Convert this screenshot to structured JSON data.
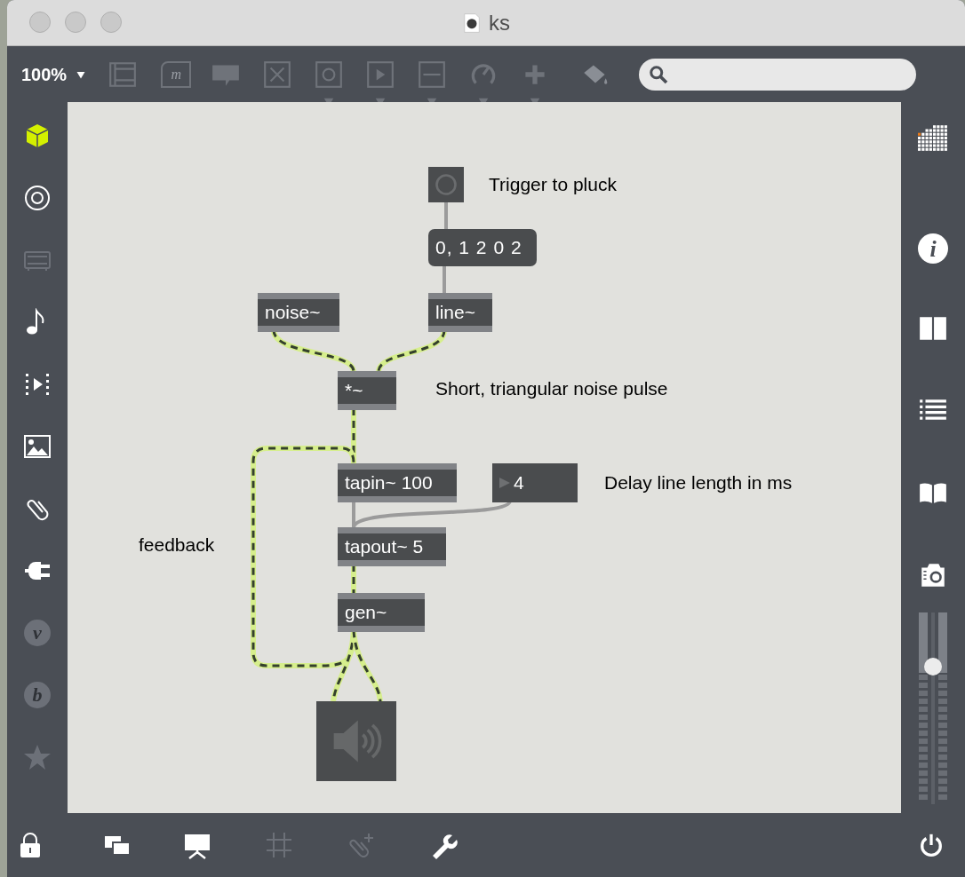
{
  "window": {
    "title": "ks"
  },
  "toolbar": {
    "zoom": "100%",
    "tools": [
      {
        "kind": "list-box",
        "menu": false
      },
      {
        "kind": "message",
        "glyph": "m",
        "menu": false
      },
      {
        "kind": "comment",
        "menu": false
      },
      {
        "kind": "toggle",
        "menu": false
      },
      {
        "kind": "button",
        "menu": true
      },
      {
        "kind": "playbar",
        "menu": true
      },
      {
        "kind": "slider",
        "menu": true
      },
      {
        "kind": "dial",
        "menu": true
      },
      {
        "kind": "plus",
        "menu": true
      },
      {
        "kind": "paint",
        "menu": false
      }
    ]
  },
  "left_sidebar": {
    "items": [
      {
        "kind": "cube",
        "disabled": false
      },
      {
        "kind": "target",
        "disabled": false
      },
      {
        "kind": "tablet",
        "disabled": true
      },
      {
        "kind": "note",
        "disabled": false
      },
      {
        "kind": "video",
        "disabled": false
      },
      {
        "kind": "image",
        "disabled": false
      },
      {
        "kind": "clip",
        "disabled": false
      },
      {
        "kind": "plug",
        "disabled": false
      },
      {
        "kind": "letter",
        "glyph": "v",
        "disabled": true
      },
      {
        "kind": "letter",
        "glyph": "b",
        "disabled": true
      },
      {
        "kind": "star",
        "disabled": true
      }
    ]
  },
  "patch": {
    "objects": [
      {
        "kind": "bang"
      },
      {
        "kind": "comment",
        "text": "Trigger to pluck"
      },
      {
        "kind": "message",
        "text": "0, 1 2 0 2"
      },
      {
        "kind": "object",
        "text": "noise~"
      },
      {
        "kind": "object",
        "text": "line~"
      },
      {
        "kind": "object",
        "text": "*~"
      },
      {
        "kind": "comment",
        "text": "Short, triangular noise pulse"
      },
      {
        "kind": "object",
        "text": "tapin~ 100"
      },
      {
        "kind": "number",
        "text": "4"
      },
      {
        "kind": "comment",
        "text": "Delay line length in ms"
      },
      {
        "kind": "comment",
        "text": "feedback"
      },
      {
        "kind": "object",
        "text": "tapout~ 5"
      },
      {
        "kind": "object",
        "text": "gen~"
      },
      {
        "kind": "dac"
      }
    ]
  },
  "right_sidebar": {
    "items": [
      {
        "kind": "grid"
      },
      {
        "kind": "info",
        "glyph": "i"
      },
      {
        "kind": "split"
      },
      {
        "kind": "list"
      },
      {
        "kind": "book"
      },
      {
        "kind": "camera"
      }
    ],
    "gain": {
      "level": 0.74
    }
  },
  "bottom_bar": {
    "items": [
      {
        "kind": "lock",
        "disabled": false
      },
      {
        "kind": "windows",
        "disabled": false
      },
      {
        "kind": "presentation",
        "disabled": false
      },
      {
        "kind": "grid-lines",
        "disabled": true
      },
      {
        "kind": "clip-plus",
        "disabled": true
      },
      {
        "kind": "wrench",
        "disabled": false
      }
    ]
  }
}
